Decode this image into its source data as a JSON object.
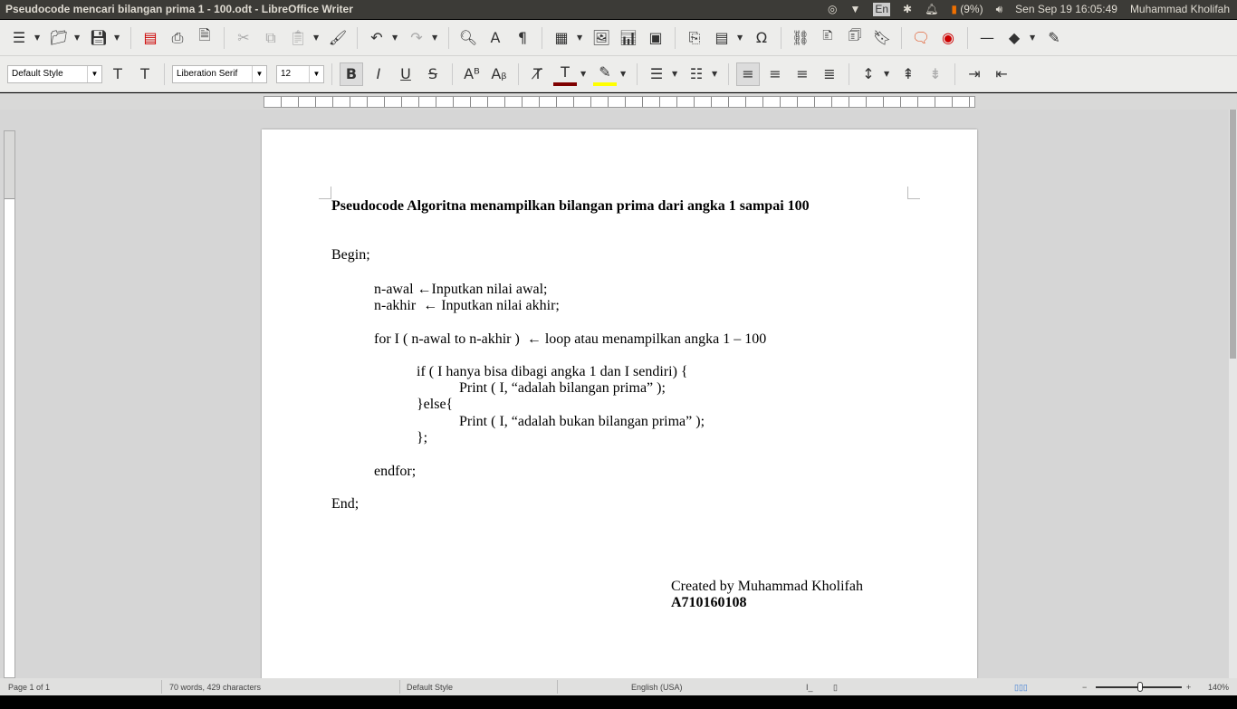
{
  "window": {
    "title": "Pseudocode mencari bilangan prima 1 - 100.odt - LibreOffice Writer"
  },
  "tray": {
    "keyboard": "En",
    "battery": "(9%)",
    "datetime": "Sen Sep 19 16:05:49",
    "user": "Muhammad Kholifah"
  },
  "format_bar": {
    "paragraph_style": "Default Style",
    "font_name": "Liberation Serif",
    "font_size": "12",
    "font_color": "#7f0000",
    "highlight_color": "#ffff00"
  },
  "document": {
    "title": "Pseudocode Algoritna menampilkan bilangan prima dari angka 1 sampai 100",
    "lines": [
      "Begin;",
      "n-awal ←Inputkan nilai awal;",
      "n-akhir  ← Inputkan nilai akhir;",
      "for I ( n-awal to n-akhir )  ← loop atau menampilkan angka 1 – 100",
      "if ( I hanya bisa dibagi angka 1 dan I sendiri) {",
      "Print ( I, “adalah bilangan prima” );",
      "}else{",
      "Print ( I, “adalah bukan bilangan prima” );",
      "};",
      "endfor;",
      "End;"
    ],
    "credit": "Created by Muhammad Kholifah",
    "nim": "A710160108"
  },
  "status": {
    "page": "Page 1 of 1",
    "words": "70 words, 429 characters",
    "style": "Default Style",
    "language": "English (USA)",
    "zoom": "140%"
  }
}
